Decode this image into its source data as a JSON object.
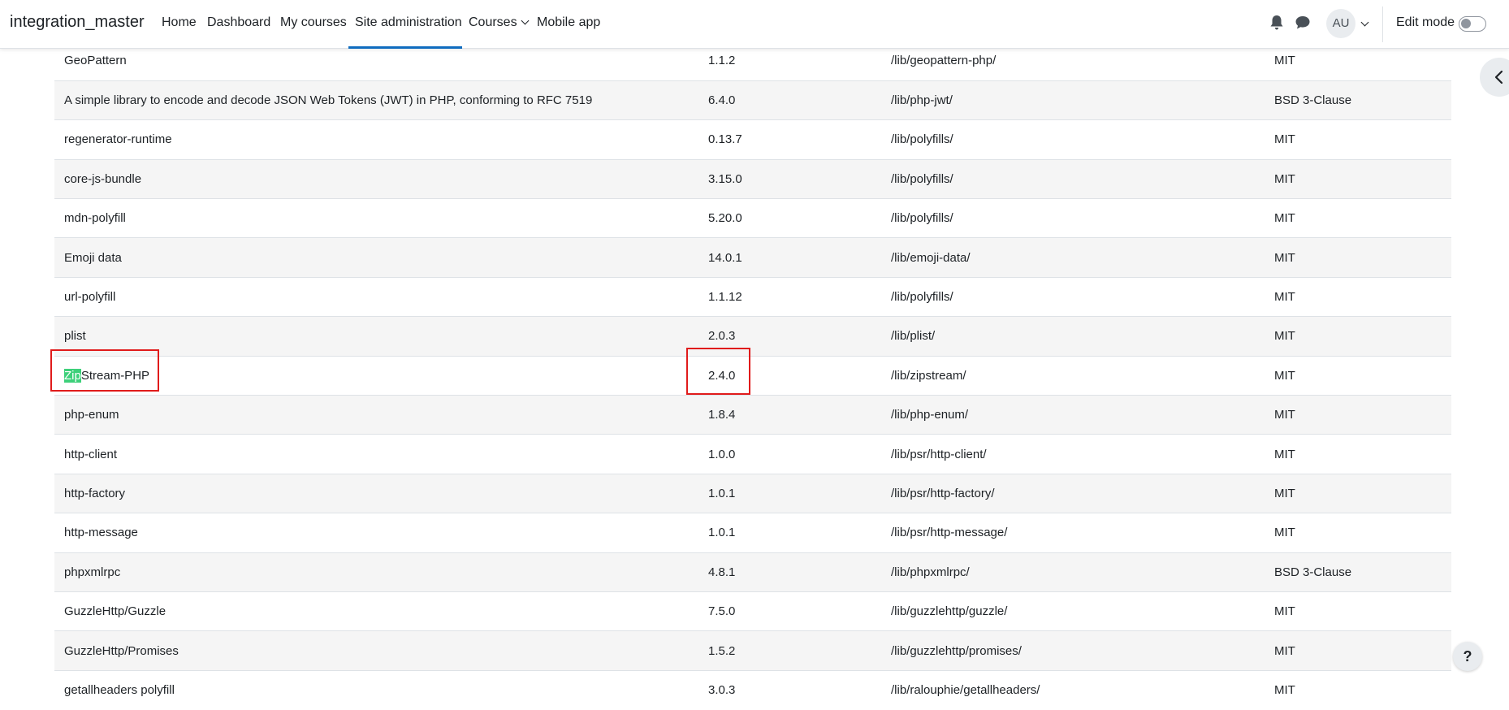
{
  "navbar": {
    "brand": "integration_master",
    "items": [
      {
        "label": "Home",
        "active": false
      },
      {
        "label": "Dashboard",
        "active": false
      },
      {
        "label": "My courses",
        "active": false
      },
      {
        "label": "Site administration",
        "active": true
      },
      {
        "label": "Courses",
        "active": false,
        "dropdown": true
      },
      {
        "label": "Mobile app",
        "active": false
      }
    ],
    "notifications_icon": "bell-icon",
    "messages_icon": "chat-bubble-icon",
    "user_initials": "AU",
    "edit_mode_label": "Edit mode",
    "edit_mode_on": false
  },
  "library_table": {
    "rows": [
      {
        "name": "GeoPattern",
        "version": "1.1.2",
        "location": "/lib/geopattern-php/",
        "license": "MIT"
      },
      {
        "name": "A simple library to encode and decode JSON Web Tokens (JWT) in PHP, conforming to RFC 7519",
        "version": "6.4.0",
        "location": "/lib/php-jwt/",
        "license": "BSD 3-Clause"
      },
      {
        "name": "regenerator-runtime",
        "version": "0.13.7",
        "location": "/lib/polyfills/",
        "license": "MIT"
      },
      {
        "name": "core-js-bundle",
        "version": "3.15.0",
        "location": "/lib/polyfills/",
        "license": "MIT"
      },
      {
        "name": "mdn-polyfill",
        "version": "5.20.0",
        "location": "/lib/polyfills/",
        "license": "MIT"
      },
      {
        "name": "Emoji data",
        "version": "14.0.1",
        "location": "/lib/emoji-data/",
        "license": "MIT"
      },
      {
        "name": "url-polyfill",
        "version": "1.1.12",
        "location": "/lib/polyfills/",
        "license": "MIT"
      },
      {
        "name": "plist",
        "version": "2.0.3",
        "location": "/lib/plist/",
        "license": "MIT"
      },
      {
        "name_highlight": "Zip",
        "name_rest": "Stream-PHP",
        "version": "2.4.0",
        "location": "/lib/zipstream/",
        "license": "MIT"
      },
      {
        "name": "php-enum",
        "version": "1.8.4",
        "location": "/lib/php-enum/",
        "license": "MIT"
      },
      {
        "name": "http-client",
        "version": "1.0.0",
        "location": "/lib/psr/http-client/",
        "license": "MIT"
      },
      {
        "name": "http-factory",
        "version": "1.0.1",
        "location": "/lib/psr/http-factory/",
        "license": "MIT"
      },
      {
        "name": "http-message",
        "version": "1.0.1",
        "location": "/lib/psr/http-message/",
        "license": "MIT"
      },
      {
        "name": "phpxmlrpc",
        "version": "4.8.1",
        "location": "/lib/phpxmlrpc/",
        "license": "BSD 3-Clause"
      },
      {
        "name": "GuzzleHttp/Guzzle",
        "version": "7.5.0",
        "location": "/lib/guzzlehttp/guzzle/",
        "license": "MIT"
      },
      {
        "name": "GuzzleHttp/Promises",
        "version": "1.5.2",
        "location": "/lib/guzzlehttp/promises/",
        "license": "MIT"
      },
      {
        "name": "getallheaders polyfill",
        "version": "3.0.3",
        "location": "/lib/ralouphie/getallheaders/",
        "license": "MIT"
      }
    ]
  },
  "colors": {
    "accent": "#0f6cbf",
    "search_highlight": "#3dd07a",
    "annotation_box": "#e01b1b",
    "stripe": "#f5f5f5"
  },
  "drawer_toggle_icon": "chevron-left-icon",
  "help_button": {
    "label": "?"
  }
}
